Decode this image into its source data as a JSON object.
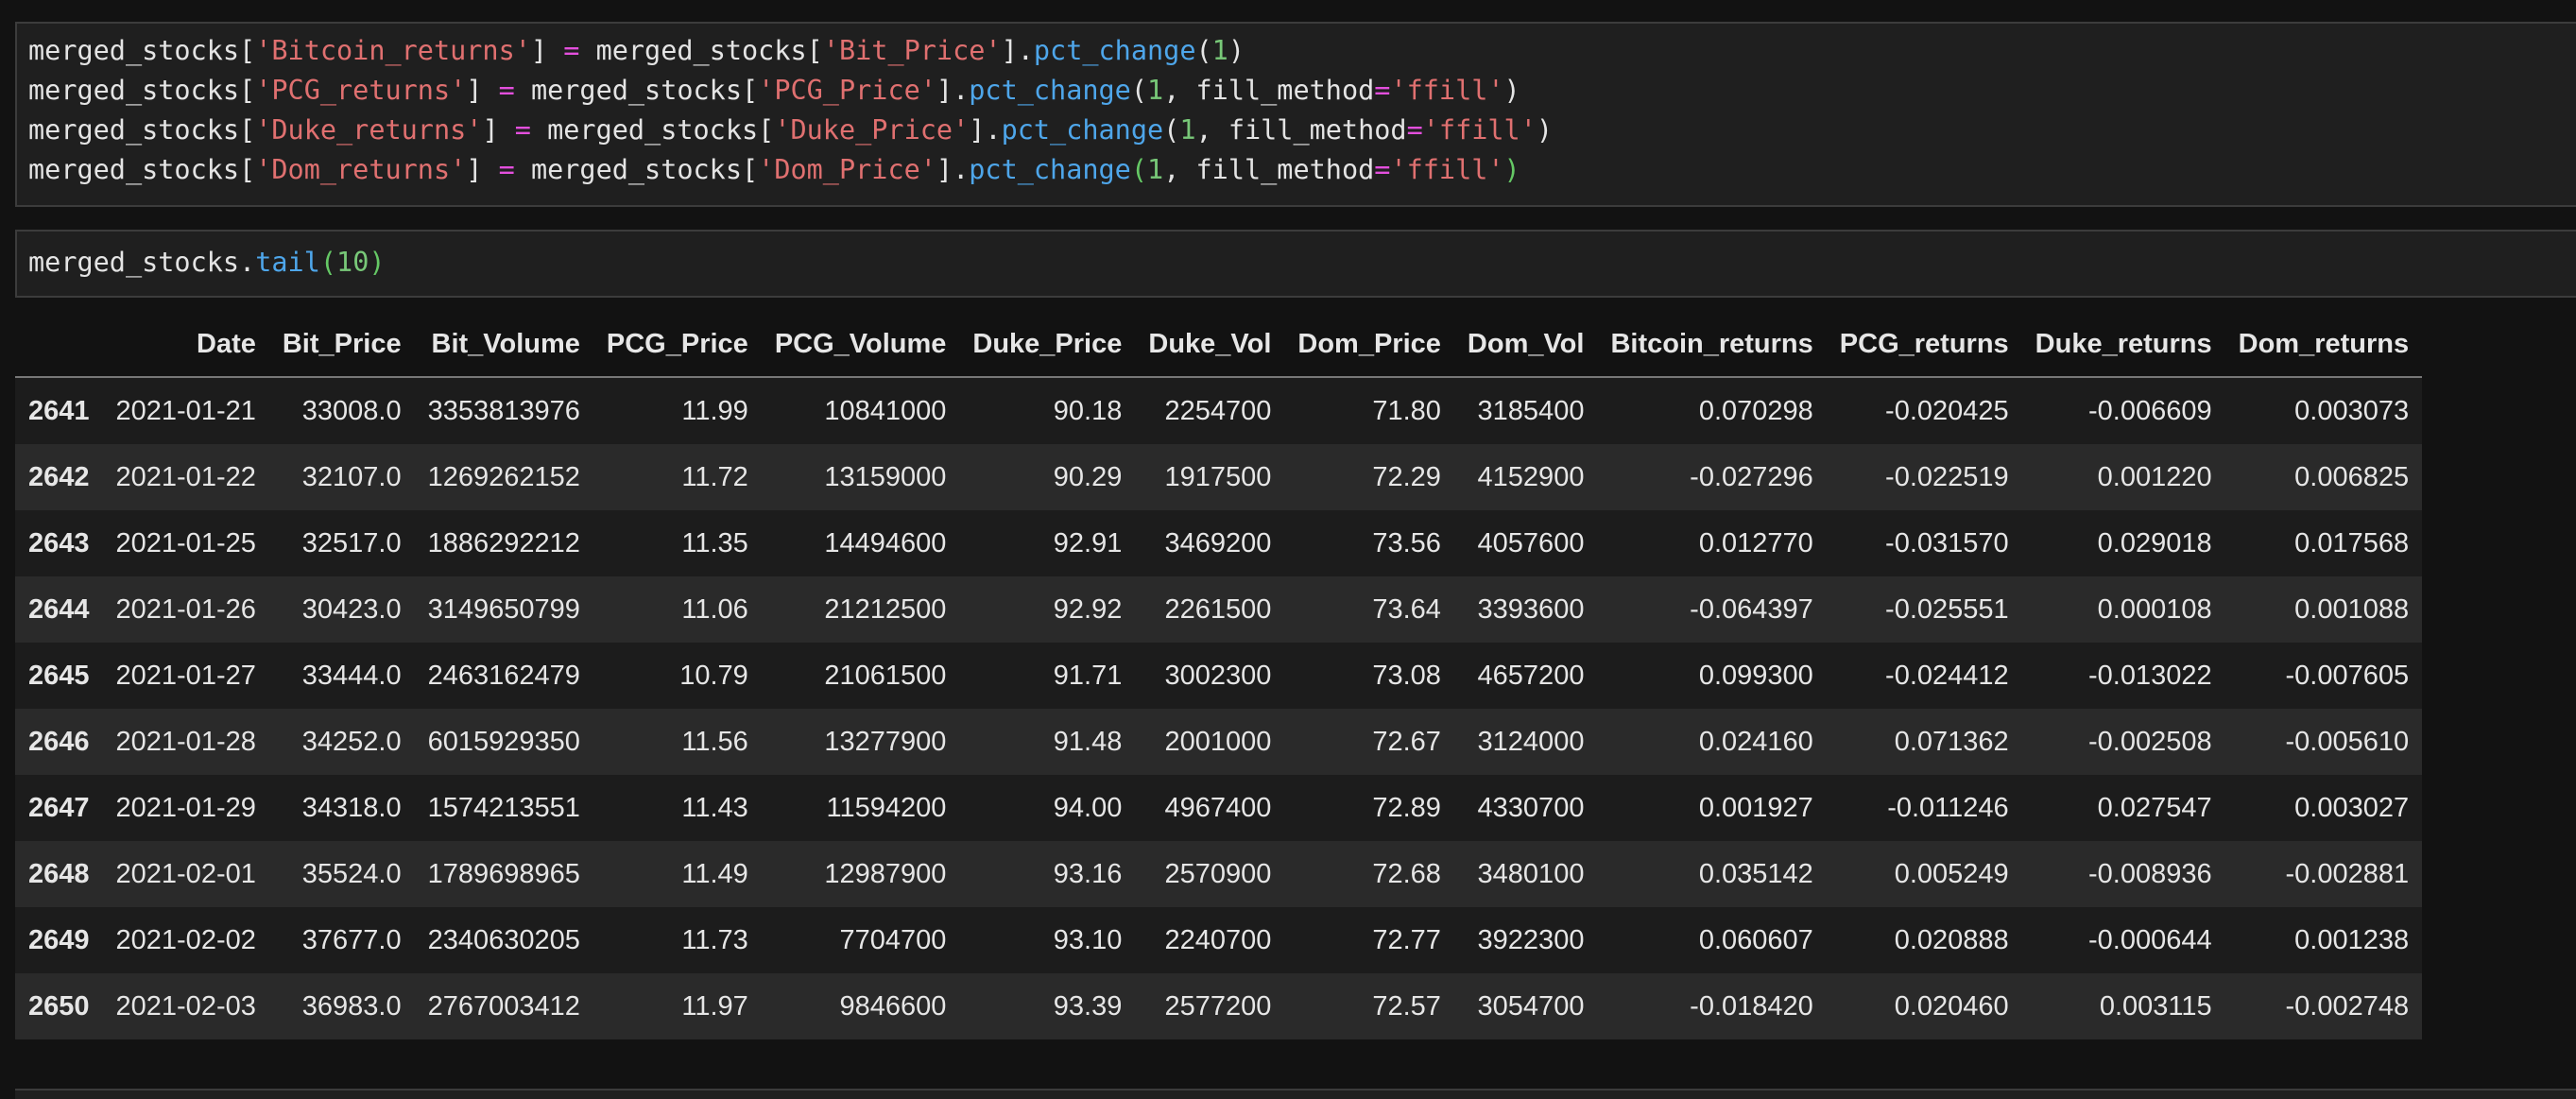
{
  "code_cell_1": {
    "lines": [
      {
        "obj": "merged_stocks[",
        "key": "'Bitcoin_returns'",
        "mid": "] ",
        "eq": "=",
        "rhs": " merged_stocks[",
        "src": "'Bit_Price'",
        "dot": "].",
        "fn": "pct_change",
        "open": "(",
        "arg": "1",
        "rest": "",
        "kw": "",
        "kwop": "",
        "kwval": "",
        "close": ")"
      },
      {
        "obj": "merged_stocks[",
        "key": "'PCG_returns'",
        "mid": "] ",
        "eq": "=",
        "rhs": " merged_stocks[",
        "src": "'PCG_Price'",
        "dot": "].",
        "fn": "pct_change",
        "open": "(",
        "arg": "1",
        "rest": ", ",
        "kw": "fill_method",
        "kwop": "=",
        "kwval": "'ffill'",
        "close": ")"
      },
      {
        "obj": "merged_stocks[",
        "key": "'Duke_returns'",
        "mid": "] ",
        "eq": "=",
        "rhs": " merged_stocks[",
        "src": "'Duke_Price'",
        "dot": "].",
        "fn": "pct_change",
        "open": "(",
        "arg": "1",
        "rest": ", ",
        "kw": "fill_method",
        "kwop": "=",
        "kwval": "'ffill'",
        "close": ")"
      },
      {
        "obj": "merged_stocks[",
        "key": "'Dom_returns'",
        "mid": "] ",
        "eq": "=",
        "rhs": " merged_stocks[",
        "src": "'Dom_Price'",
        "dot": "].",
        "fn": "pct_change",
        "open": "(",
        "arg": "1",
        "rest": ", ",
        "kw": "fill_method",
        "kwop": "=",
        "kwval": "'ffill'",
        "close": ")"
      }
    ]
  },
  "code_cell_2": {
    "obj": "merged_stocks.",
    "fn": "tail",
    "open": "(",
    "arg": "10",
    "close": ")"
  },
  "table": {
    "columns": [
      "",
      "Date",
      "Bit_Price",
      "Bit_Volume",
      "PCG_Price",
      "PCG_Volume",
      "Duke_Price",
      "Duke_Vol",
      "Dom_Price",
      "Dom_Vol",
      "Bitcoin_returns",
      "PCG_returns",
      "Duke_returns",
      "Dom_returns"
    ],
    "rows": [
      [
        "2641",
        "2021-01-21",
        "33008.0",
        "3353813976",
        "11.99",
        "10841000",
        "90.18",
        "2254700",
        "71.80",
        "3185400",
        "0.070298",
        "-0.020425",
        "-0.006609",
        "0.003073"
      ],
      [
        "2642",
        "2021-01-22",
        "32107.0",
        "1269262152",
        "11.72",
        "13159000",
        "90.29",
        "1917500",
        "72.29",
        "4152900",
        "-0.027296",
        "-0.022519",
        "0.001220",
        "0.006825"
      ],
      [
        "2643",
        "2021-01-25",
        "32517.0",
        "1886292212",
        "11.35",
        "14494600",
        "92.91",
        "3469200",
        "73.56",
        "4057600",
        "0.012770",
        "-0.031570",
        "0.029018",
        "0.017568"
      ],
      [
        "2644",
        "2021-01-26",
        "30423.0",
        "3149650799",
        "11.06",
        "21212500",
        "92.92",
        "2261500",
        "73.64",
        "3393600",
        "-0.064397",
        "-0.025551",
        "0.000108",
        "0.001088"
      ],
      [
        "2645",
        "2021-01-27",
        "33444.0",
        "2463162479",
        "10.79",
        "21061500",
        "91.71",
        "3002300",
        "73.08",
        "4657200",
        "0.099300",
        "-0.024412",
        "-0.013022",
        "-0.007605"
      ],
      [
        "2646",
        "2021-01-28",
        "34252.0",
        "6015929350",
        "11.56",
        "13277900",
        "91.48",
        "2001000",
        "72.67",
        "3124000",
        "0.024160",
        "0.071362",
        "-0.002508",
        "-0.005610"
      ],
      [
        "2647",
        "2021-01-29",
        "34318.0",
        "1574213551",
        "11.43",
        "11594200",
        "94.00",
        "4967400",
        "72.89",
        "4330700",
        "0.001927",
        "-0.011246",
        "0.027547",
        "0.003027"
      ],
      [
        "2648",
        "2021-02-01",
        "35524.0",
        "1789698965",
        "11.49",
        "12987900",
        "93.16",
        "2570900",
        "72.68",
        "3480100",
        "0.035142",
        "0.005249",
        "-0.008936",
        "-0.002881"
      ],
      [
        "2649",
        "2021-02-02",
        "37677.0",
        "2340630205",
        "11.73",
        "7704700",
        "93.10",
        "2240700",
        "72.77",
        "3922300",
        "0.060607",
        "0.020888",
        "-0.000644",
        "0.001238"
      ],
      [
        "2650",
        "2021-02-03",
        "36983.0",
        "2767003412",
        "11.97",
        "9846600",
        "93.39",
        "2577200",
        "72.57",
        "3054700",
        "-0.018420",
        "0.020460",
        "0.003115",
        "-0.002748"
      ]
    ]
  },
  "colors": {
    "background": "#121212",
    "cell_background": "#1f1f1f",
    "string": "#e07070",
    "number": "#78c878",
    "function": "#4ea6ea",
    "operator": "#e34fdd"
  }
}
